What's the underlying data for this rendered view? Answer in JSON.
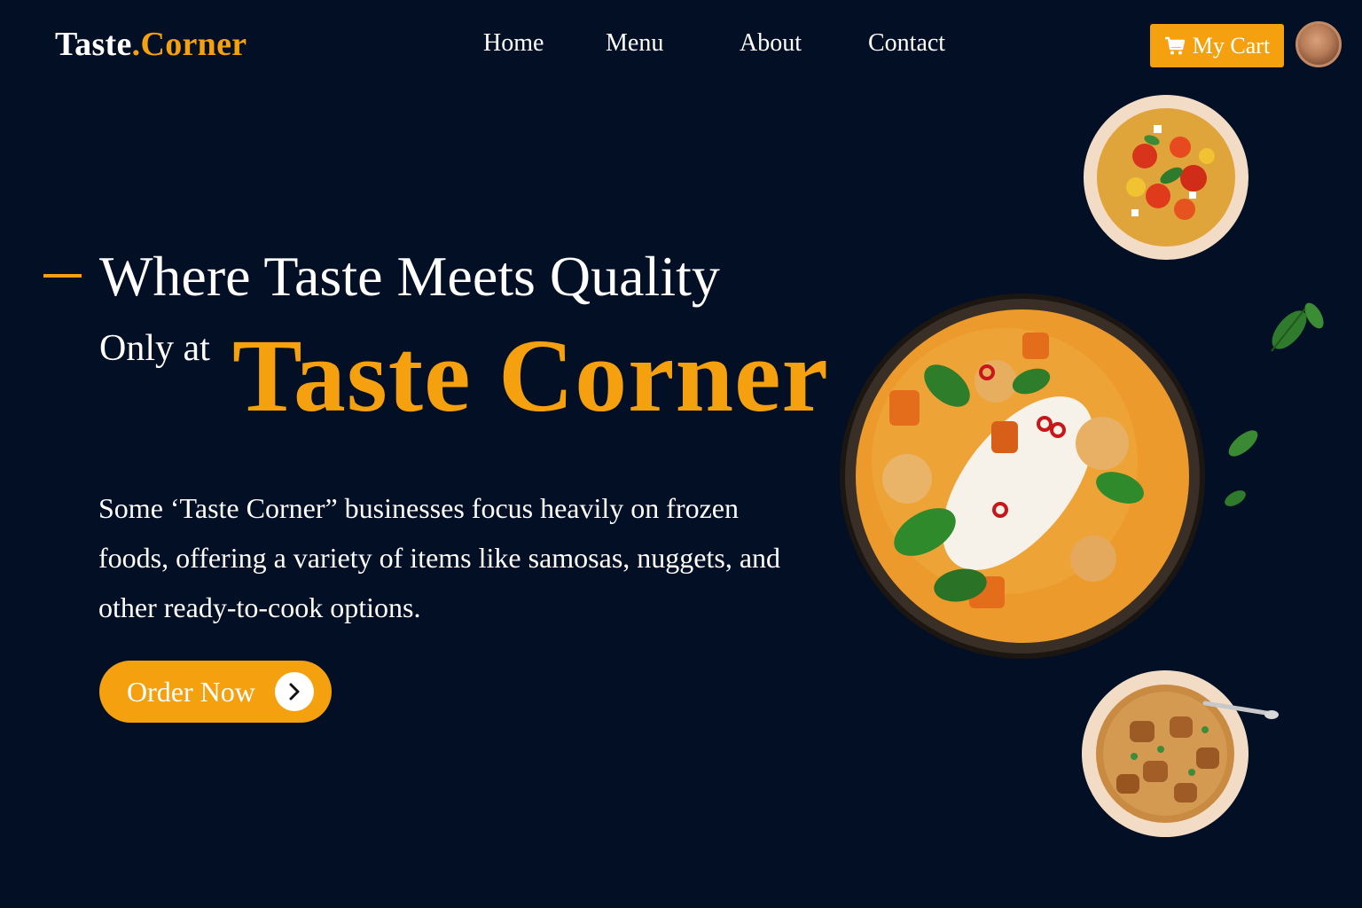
{
  "header": {
    "logo_part1": "Taste",
    "logo_part2": ".Corner",
    "nav": {
      "home": "Home",
      "menu": "Menu",
      "about": "About",
      "contact": "Contact"
    },
    "cart_label": "My Cart",
    "cart_icon": "cart-icon"
  },
  "hero": {
    "tagline": "Where Taste Meets Quality",
    "only_at": "Only at",
    "brand": "Taste Corner",
    "description": "Some ‘Taste Corner” businesses focus heavily on frozen foods, offering a variety of items like samosas, nuggets, and other ready-to-cook options.",
    "order_label": "Order Now",
    "order_icon": "chevron-right-icon"
  },
  "colors": {
    "background": "#020f24",
    "accent": "#f5a10f",
    "text": "#ffffff"
  }
}
